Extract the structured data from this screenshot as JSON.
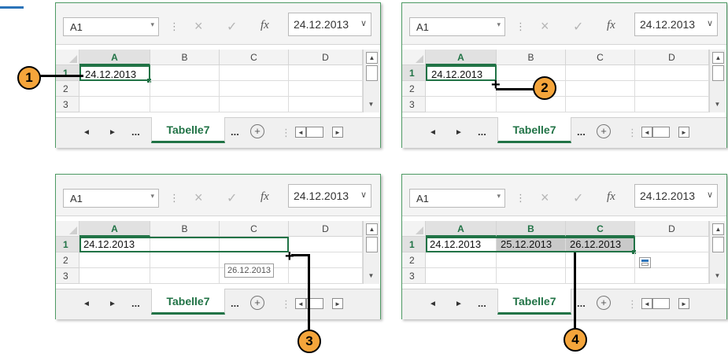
{
  "formula_bar": {
    "name_box": "A1",
    "formula_value": "24.12.2013",
    "cancel_glyph": "×",
    "enter_glyph": "✓",
    "fx_label": "fx",
    "separator": "⋮",
    "dropdown_arrow": "▾",
    "chevron": "⌄"
  },
  "columns": [
    "A",
    "B",
    "C",
    "D"
  ],
  "rows": [
    "1",
    "2",
    "3"
  ],
  "cell_a1": "24.12.2013",
  "cell_b1": "25.12.2013",
  "cell_c1": "26.12.2013",
  "tooltip_value": "26.12.2013",
  "sheet_tab": "Tabelle7",
  "tab_nav": {
    "prev": "◄",
    "next": "►",
    "ellipsis": "...",
    "add": "+"
  },
  "callouts": [
    "1",
    "2",
    "3",
    "4"
  ],
  "fill_handle_cursor": "+",
  "colors": {
    "accent": "#217346",
    "callout": "#f5a53b",
    "panel_border": "#4d9a63",
    "selection_fill": "#c9c9c9"
  },
  "icons": [
    "close-icon",
    "check-icon",
    "function-icon",
    "plus-circle-icon",
    "autofill-options-icon"
  ]
}
